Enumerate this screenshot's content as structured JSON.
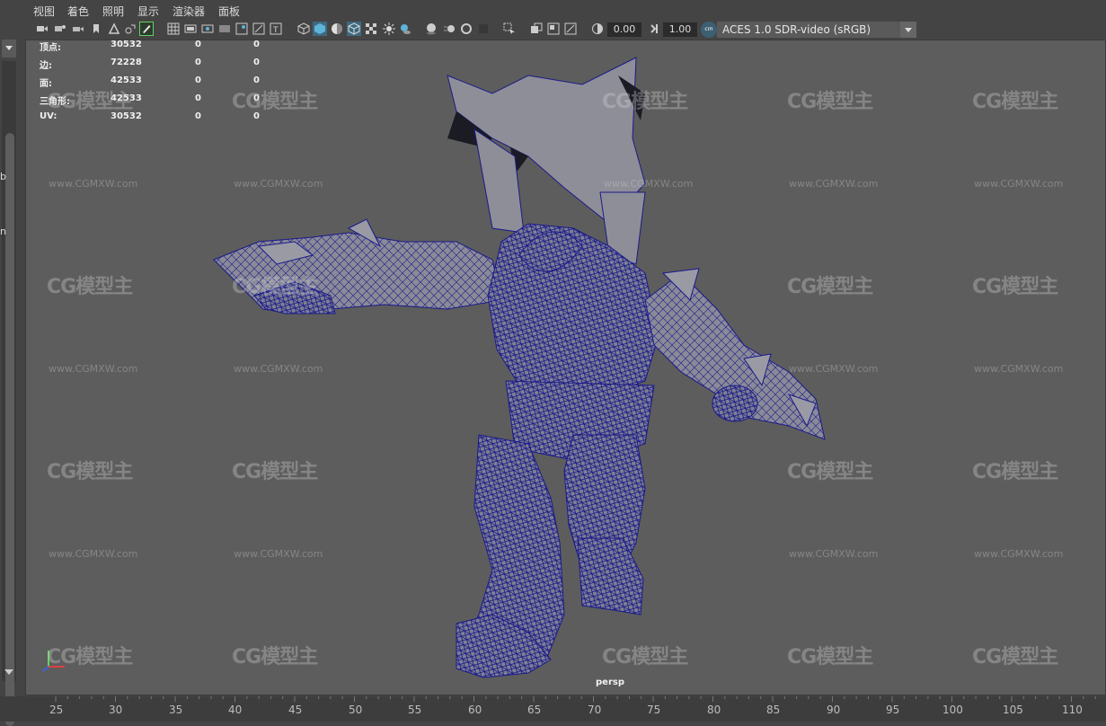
{
  "menu": [
    "视图",
    "着色",
    "照明",
    "显示",
    "渲染器",
    "面板"
  ],
  "toolbar": {
    "exposure_value": "0.00",
    "gamma_value": "1.00",
    "aces_badge": "cm",
    "color_space": "ACES 1.0 SDR-video (sRGB)"
  },
  "left_edge_letters": [
    "b",
    "n"
  ],
  "hud": {
    "rows": [
      {
        "label": "顶点:",
        "v1": "30532",
        "v2": "0",
        "v3": "0"
      },
      {
        "label": "边:",
        "v1": "72228",
        "v2": "0",
        "v3": "0"
      },
      {
        "label": "面:",
        "v1": "42533",
        "v2": "0",
        "v3": "0"
      },
      {
        "label": "三角形:",
        "v1": "42533",
        "v2": "0",
        "v3": "0"
      },
      {
        "label": "UV:",
        "v1": "30532",
        "v2": "0",
        "v3": "0"
      }
    ]
  },
  "camera_label": "persp",
  "watermark": {
    "logo": "CG模型主",
    "url": "www.CGMXW.com"
  },
  "timeline": {
    "ticks": [
      "25",
      "30",
      "35",
      "40",
      "45",
      "50",
      "55",
      "60",
      "65",
      "70",
      "75",
      "80",
      "85",
      "90",
      "95",
      "100",
      "105",
      "110"
    ]
  },
  "colors": {
    "viewport_bg": "#5d5d5d",
    "wireframe": "#1a1a8a",
    "mesh_fill": "#8c8c96",
    "ui_bg": "#444444",
    "accent_active": "#5fb3d8"
  }
}
